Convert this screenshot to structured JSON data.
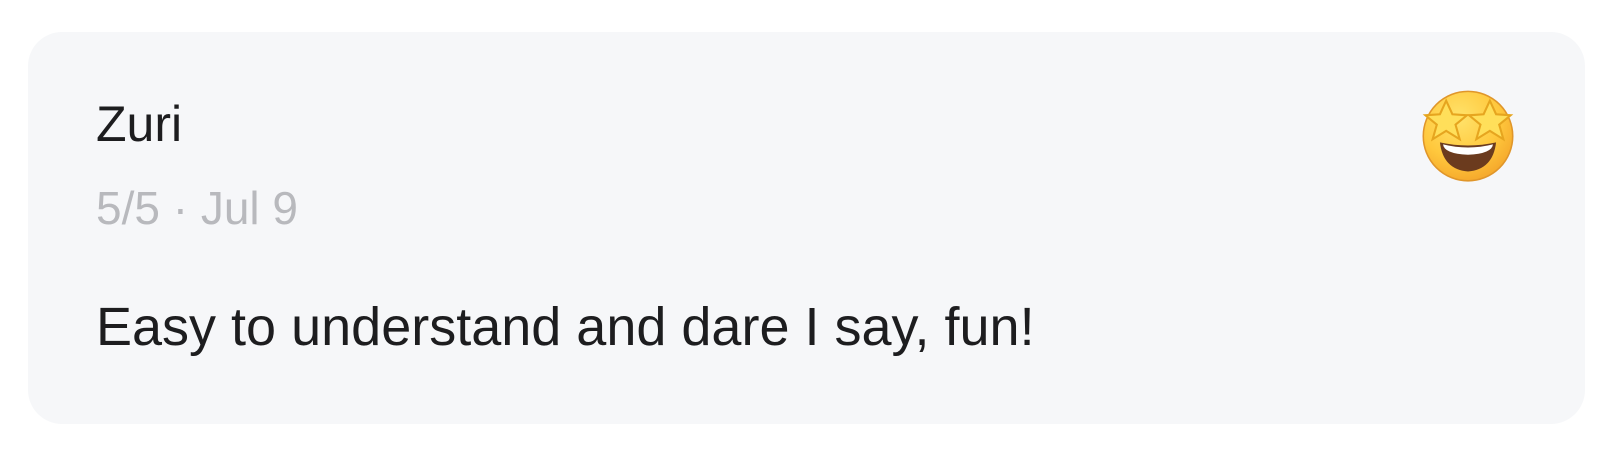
{
  "review": {
    "name": "Zuri",
    "rating": "5/5",
    "separator": "·",
    "date": "Jul 9",
    "text": "Easy to understand and dare I say, fun!",
    "emoji_icon": "star-struck-emoji-icon"
  },
  "colors": {
    "card_background": "#f6f7f9",
    "text_primary": "#1d1d1f",
    "text_secondary": "#b8b9bd"
  }
}
